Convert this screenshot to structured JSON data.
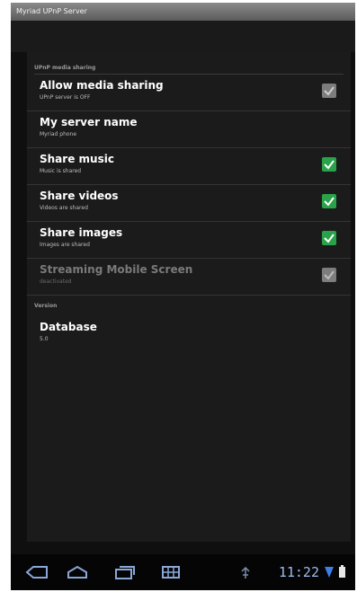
{
  "app": {
    "title": "Myriad UPnP Server"
  },
  "sections": {
    "media_header": "UPnP media sharing",
    "version_header": "Version"
  },
  "settings": [
    {
      "title": "Allow media sharing",
      "subtitle": "UPnP server is OFF",
      "checked": true,
      "enabled": false
    },
    {
      "title": "My server name",
      "subtitle": "Myriad phone"
    },
    {
      "title": "Share music",
      "subtitle": "Music is shared",
      "checked": true,
      "enabled": true
    },
    {
      "title": "Share videos",
      "subtitle": "Videos are shared",
      "checked": true,
      "enabled": true
    },
    {
      "title": "Share images",
      "subtitle": "Images are shared",
      "checked": true,
      "enabled": true
    },
    {
      "title": "Streaming Mobile Screen",
      "subtitle": "deactivated",
      "checked": true,
      "enabled": false
    }
  ],
  "version": {
    "title": "Database",
    "value": "5.0"
  },
  "navbar": {
    "time": "11:22"
  },
  "icons": [
    "back-icon",
    "home-icon",
    "recent-apps-icon",
    "grid-menu-icon",
    "usb-icon",
    "wifi-icon",
    "battery-icon"
  ]
}
